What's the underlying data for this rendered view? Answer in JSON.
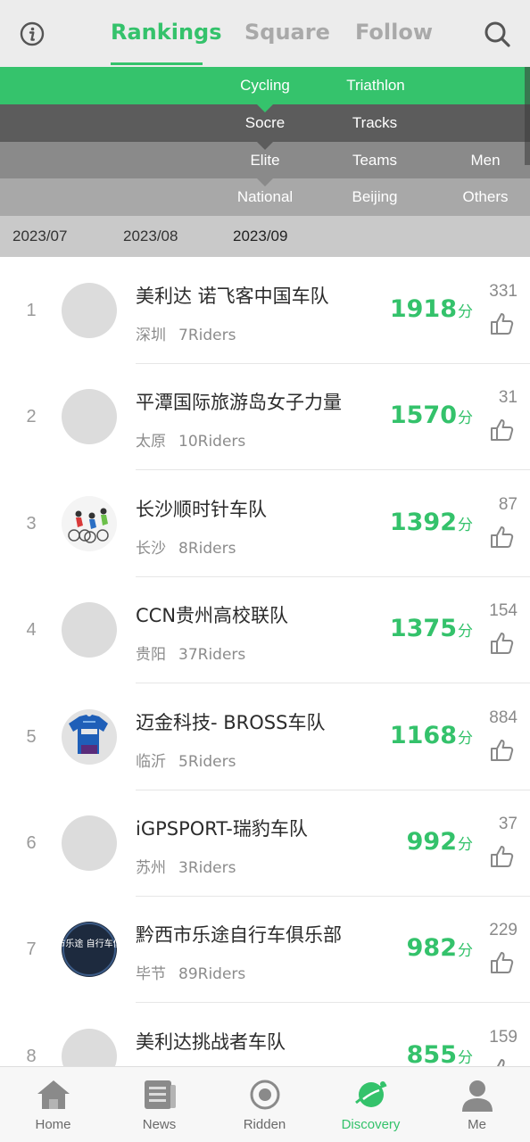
{
  "header": {
    "tabs": [
      {
        "label": "Rankings",
        "active": true
      },
      {
        "label": "Square",
        "active": false
      },
      {
        "label": "Follow",
        "active": false
      }
    ]
  },
  "filters": {
    "sport": [
      "Cycling",
      "Triathlon"
    ],
    "category": [
      "Socre",
      "Tracks"
    ],
    "level": [
      "Elite",
      "Teams",
      "Men"
    ],
    "region": [
      "National",
      "Beijing",
      "Others"
    ],
    "months": [
      "2023/07",
      "2023/08",
      "2023/09"
    ],
    "selected_month": "2023/09"
  },
  "rankings": [
    {
      "rank": "1",
      "name": "美利达 诺飞客中国车队",
      "city": "深圳",
      "riders": "7Riders",
      "score": "1918",
      "unit": "分",
      "likes": "331",
      "avatar": "placeholder"
    },
    {
      "rank": "2",
      "name": "平潭国际旅游岛女子力量",
      "city": "太原",
      "riders": "10Riders",
      "score": "1570",
      "unit": "分",
      "likes": "31",
      "avatar": "placeholder"
    },
    {
      "rank": "3",
      "name": "长沙顺时针车队",
      "city": "长沙",
      "riders": "8Riders",
      "score": "1392",
      "unit": "分",
      "likes": "87",
      "avatar": "cyclists-logo"
    },
    {
      "rank": "4",
      "name": "CCN贵州高校联队",
      "city": "贵阳",
      "riders": "37Riders",
      "score": "1375",
      "unit": "分",
      "likes": "154",
      "avatar": "placeholder"
    },
    {
      "rank": "5",
      "name": "迈金科技- BROSS车队",
      "city": "临沂",
      "riders": "5Riders",
      "score": "1168",
      "unit": "分",
      "likes": "884",
      "avatar": "jersey-logo"
    },
    {
      "rank": "6",
      "name": "iGPSPORT-瑞豹车队",
      "city": "苏州",
      "riders": "3Riders",
      "score": "992",
      "unit": "分",
      "likes": "37",
      "avatar": "placeholder"
    },
    {
      "rank": "7",
      "name": "黔西市乐途自行车俱乐部",
      "city": "毕节",
      "riders": "89Riders",
      "score": "982",
      "unit": "分",
      "likes": "229",
      "avatar": "club-logo",
      "avatar_text": "黔西市乐途 自行车俱乐部"
    },
    {
      "rank": "8",
      "name": "美利达挑战者车队",
      "city": "",
      "riders": "",
      "score": "855",
      "unit": "分",
      "likes": "159",
      "avatar": "placeholder"
    }
  ],
  "bottom_nav": [
    {
      "label": "Home",
      "icon": "home-icon",
      "active": false
    },
    {
      "label": "News",
      "icon": "news-icon",
      "active": false
    },
    {
      "label": "Ridden",
      "icon": "ridden-icon",
      "active": false
    },
    {
      "label": "Discovery",
      "icon": "discovery-icon",
      "active": true
    },
    {
      "label": "Me",
      "icon": "me-icon",
      "active": false
    }
  ],
  "colors": {
    "accent": "#34c26b",
    "row_green": "#35c36c",
    "row_dark": "#5c5c5c",
    "row_mid": "#8a8a8a",
    "row_light": "#a8a8a8",
    "date_row": "#c9c9c9"
  }
}
